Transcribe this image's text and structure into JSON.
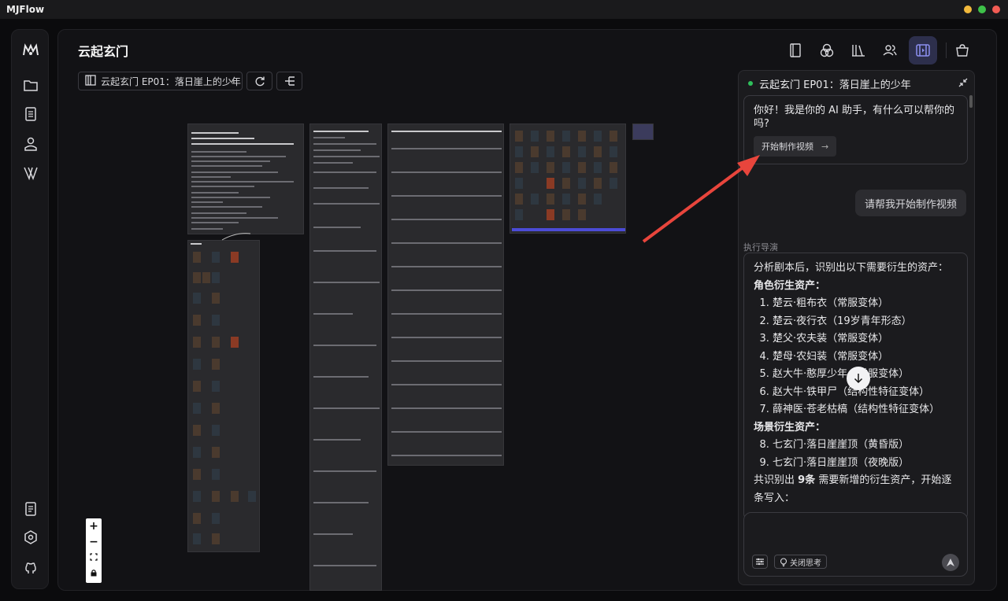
{
  "app": {
    "name": "MJFlow"
  },
  "page": {
    "title": "云起玄门"
  },
  "episode_select": {
    "value": "云起玄门 EP01：落日崖上的少年"
  },
  "sidebar": {
    "items": [
      {
        "name": "logo",
        "icon": "mj-logo-icon"
      },
      {
        "name": "folder",
        "icon": "folder-icon"
      },
      {
        "name": "script",
        "icon": "document-icon"
      },
      {
        "name": "user",
        "icon": "user-icon"
      },
      {
        "name": "v-logo",
        "icon": "v-logo-icon"
      },
      {
        "name": "notes",
        "icon": "notes-icon"
      },
      {
        "name": "settings",
        "icon": "settings-icon"
      },
      {
        "name": "github",
        "icon": "github-icon"
      }
    ]
  },
  "top_tools": [
    {
      "name": "script",
      "icon": "script-icon"
    },
    {
      "name": "style",
      "icon": "palette-icon"
    },
    {
      "name": "library",
      "icon": "library-icon"
    },
    {
      "name": "characters",
      "icon": "people-icon"
    },
    {
      "name": "video",
      "icon": "video-icon",
      "active": true
    },
    {
      "name": "shop",
      "icon": "bag-icon"
    }
  ],
  "chat": {
    "title": "云起玄门 EP01：落日崖上的少年",
    "greeting": "你好！我是你的 AI 助手，有什么可以帮你的吗?",
    "start_button": "开始制作视频",
    "start_arrow": "→",
    "user_message": "请帮我开始制作视频",
    "exec_label": "执行导演",
    "exec": {
      "intro": "分析剧本后，识别出以下需要衍生的资产：",
      "char_heading": "角色衍生资产：",
      "char_items": [
        "楚云·粗布衣（常服变体）",
        "楚云·夜行衣（19岁青年形态）",
        "楚父·农夫装（常服变体）",
        "楚母·农妇装（常服变体）",
        "赵大牛·憨厚少年（常服变体）",
        "赵大牛·铁甲尸（结构性特征变体）",
        "薛神医·苍老枯槁（结构性特征变体）"
      ],
      "scene_heading": "场景衍生资产：",
      "scene_items": [
        "七玄门·落日崖崖顶（黄昏版）",
        "七玄门·落日崖崖顶（夜晚版）"
      ],
      "summary_prefix": "共识别出 ",
      "summary_count": "9条",
      "summary_suffix": " 需要新增的衍生资产，开始逐条写入："
    },
    "think_button": "关闭思考"
  },
  "colors": {
    "accent": "#4b4bd6",
    "arrow": "#e8453c",
    "status": "#2fbf5b"
  }
}
